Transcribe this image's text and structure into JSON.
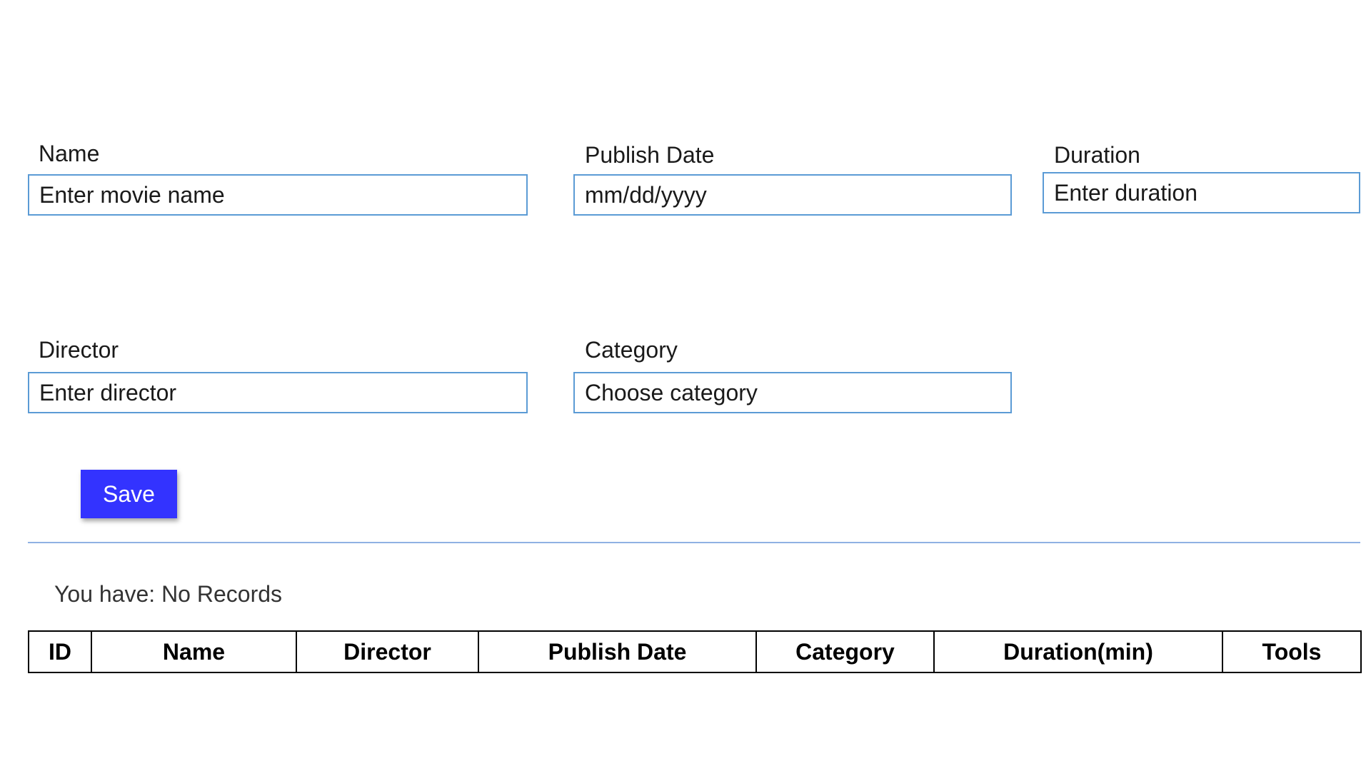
{
  "form": {
    "name": {
      "label": "Name",
      "placeholder": "Enter movie name"
    },
    "publish_date": {
      "label": "Publish Date",
      "placeholder": "mm/dd/yyyy"
    },
    "duration": {
      "label": "Duration",
      "placeholder": "Enter duration"
    },
    "director": {
      "label": "Director",
      "placeholder": "Enter director"
    },
    "category": {
      "label": "Category",
      "placeholder": "Choose category"
    },
    "save_label": "Save"
  },
  "records": {
    "status_text": "You have: No Records",
    "columns": [
      "ID",
      "Name",
      "Director",
      "Publish Date",
      "Category",
      "Duration(min)",
      "Tools"
    ]
  },
  "colors": {
    "input_border": "#5b9bd5",
    "save_button": "#3333ff",
    "divider": "#8fb1e3"
  }
}
